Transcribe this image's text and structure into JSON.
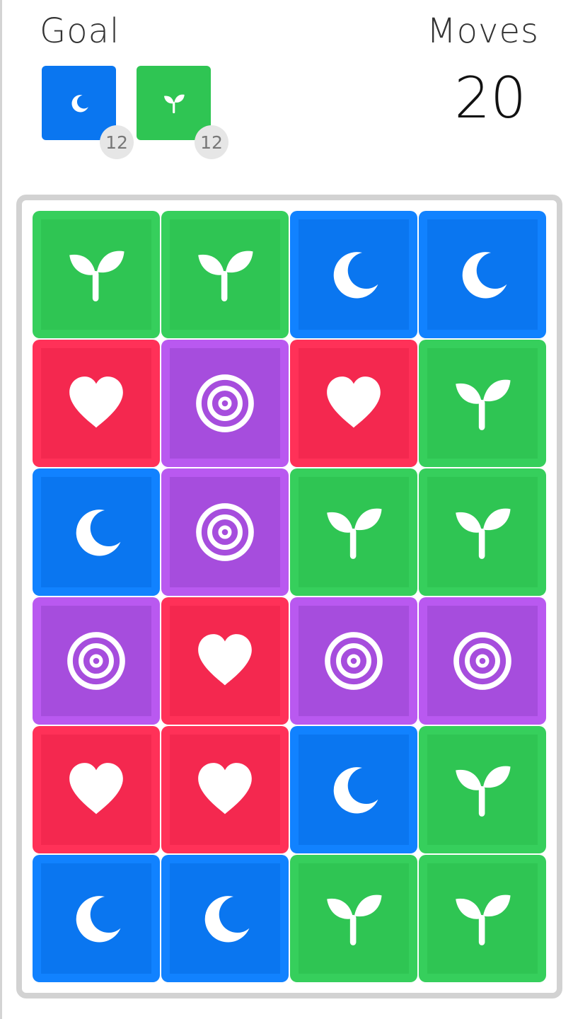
{
  "header": {
    "goal_label": "Goal",
    "moves_label": "Moves",
    "moves_remaining": "20"
  },
  "goals": [
    {
      "icon": "moon-icon",
      "color": "#0a76f0",
      "count": "12"
    },
    {
      "icon": "sprout-icon",
      "color": "#2fc553",
      "count": "12"
    }
  ],
  "colors": {
    "moon": "#0a76f0",
    "sprout": "#2fc553",
    "heart": "#f4284f",
    "target": "#a64ddd"
  },
  "board": {
    "rows": 6,
    "cols": 4,
    "grid": [
      [
        "sprout",
        "sprout",
        "moon",
        "moon"
      ],
      [
        "heart",
        "target",
        "heart",
        "sprout"
      ],
      [
        "moon",
        "target",
        "sprout",
        "sprout"
      ],
      [
        "target",
        "heart",
        "target",
        "target"
      ],
      [
        "heart",
        "heart",
        "moon",
        "sprout"
      ],
      [
        "moon",
        "moon",
        "sprout",
        "sprout"
      ]
    ]
  }
}
